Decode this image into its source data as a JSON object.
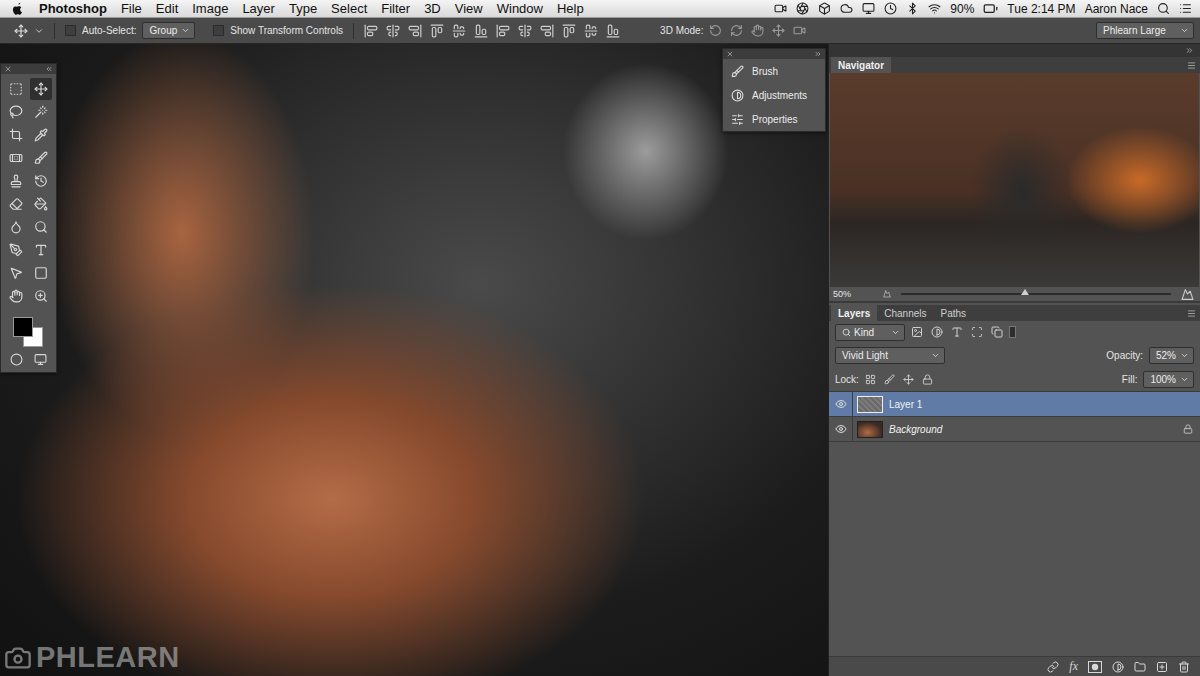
{
  "menubar": {
    "app": "Photoshop",
    "menus": [
      "File",
      "Edit",
      "Image",
      "Layer",
      "Type",
      "Select",
      "Filter",
      "3D",
      "View",
      "Window",
      "Help"
    ],
    "status": {
      "battery": "90%",
      "clock": "Tue 2:14 PM",
      "user": "Aaron Nace"
    }
  },
  "options_bar": {
    "auto_select": {
      "label": "Auto-Select:",
      "checked": false
    },
    "auto_select_target": "Group",
    "transform_controls": {
      "label": "Show Transform Controls",
      "checked": false
    },
    "mode_label": "3D Mode:",
    "workspace": "Phlearn Large"
  },
  "tools": [
    {
      "kind": "marquee",
      "selected": false
    },
    {
      "kind": "move",
      "selected": true
    },
    {
      "kind": "lasso",
      "selected": false
    },
    {
      "kind": "wand",
      "selected": false
    },
    {
      "kind": "crop",
      "selected": false
    },
    {
      "kind": "eyedropper",
      "selected": false
    },
    {
      "kind": "heal",
      "selected": false
    },
    {
      "kind": "brush",
      "selected": false
    },
    {
      "kind": "stamp",
      "selected": false
    },
    {
      "kind": "history",
      "selected": false
    },
    {
      "kind": "eraser",
      "selected": false
    },
    {
      "kind": "bucket",
      "selected": false
    },
    {
      "kind": "blur",
      "selected": false
    },
    {
      "kind": "dodge",
      "selected": false
    },
    {
      "kind": "pen",
      "selected": false
    },
    {
      "kind": "type",
      "selected": false
    },
    {
      "kind": "select",
      "selected": false
    },
    {
      "kind": "shape",
      "selected": false
    },
    {
      "kind": "hand",
      "selected": false
    },
    {
      "kind": "zoom",
      "selected": false
    }
  ],
  "swatches": {
    "foreground": "#000000",
    "background": "#ffffff"
  },
  "side_panels": [
    {
      "label": "Brush"
    },
    {
      "label": "Adjustments"
    },
    {
      "label": "Properties"
    }
  ],
  "navigator": {
    "title": "Navigator",
    "zoom": "50%",
    "level": 0.46
  },
  "layers_panel": {
    "tabs": [
      {
        "label": "Layers",
        "selected": true
      },
      {
        "label": "Channels",
        "selected": false
      },
      {
        "label": "Paths",
        "selected": false
      }
    ],
    "filter": "Kind",
    "blend_mode": "Vivid Light",
    "opacity_label": "Opacity:",
    "opacity": "52%",
    "lock_label": "Lock:",
    "fill_label": "Fill:",
    "fill": "100%",
    "layers": [
      {
        "name": "Layer 1",
        "kind": "layer",
        "visible": true,
        "selected": true,
        "locked": false
      },
      {
        "name": "Background",
        "kind": "background",
        "visible": true,
        "selected": false,
        "locked": true
      }
    ],
    "footer_fx": "fx"
  },
  "watermark": "PHLEARN"
}
